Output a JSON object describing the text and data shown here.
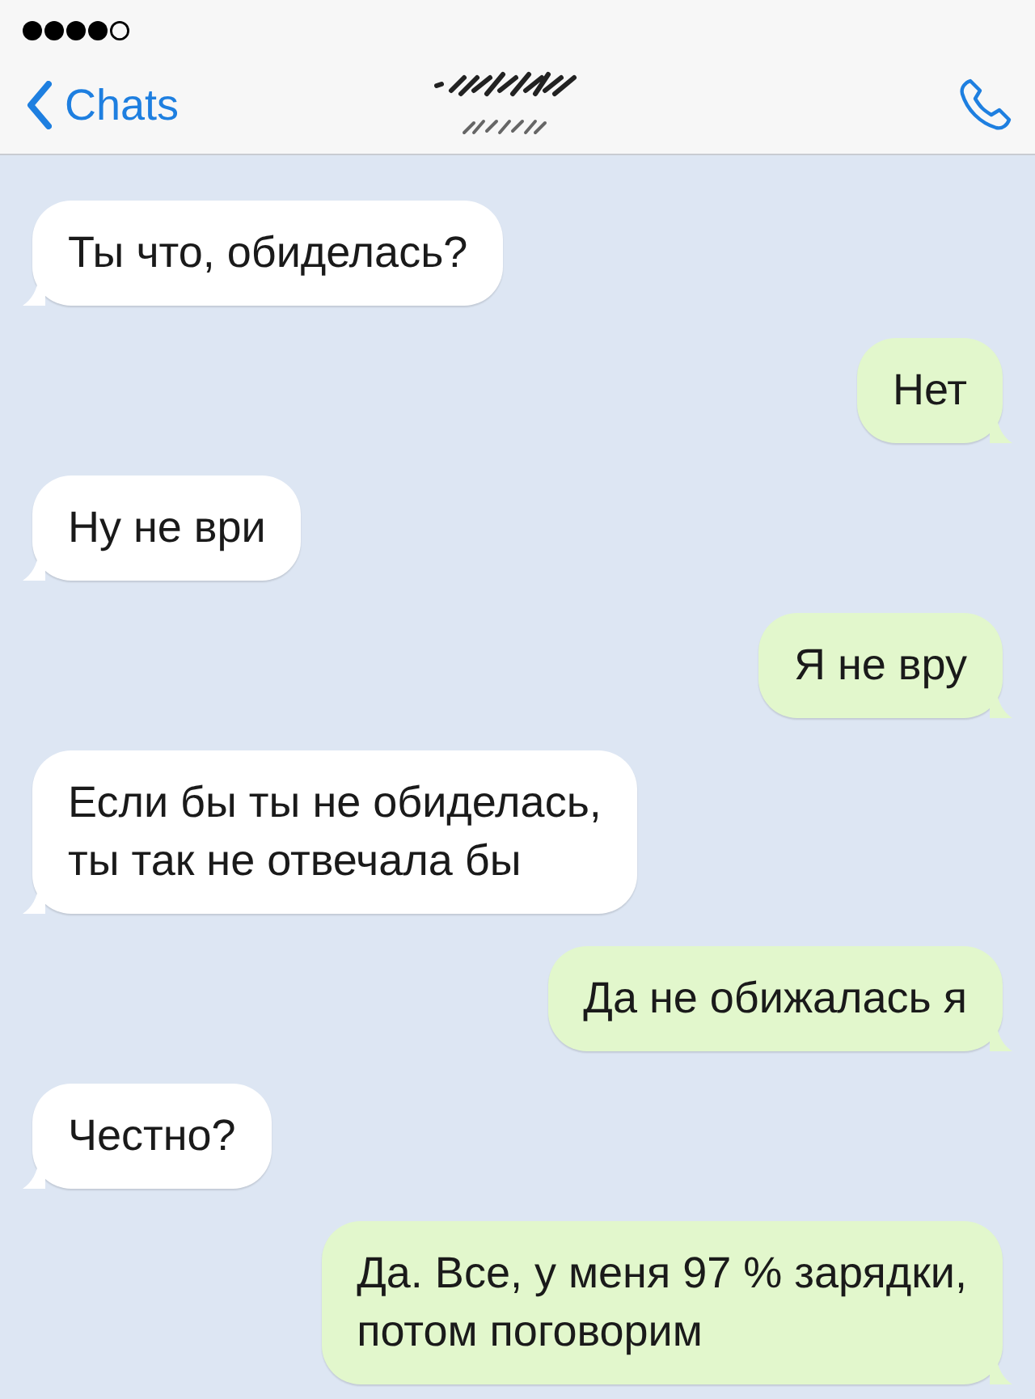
{
  "nav_bar": {
    "back_label": "Chats"
  },
  "messages": [
    {
      "kind": "incoming",
      "text": "Ты что, обиделась?"
    },
    {
      "kind": "outgoing",
      "text": "Нет"
    },
    {
      "kind": "incoming",
      "text": "Ну не ври"
    },
    {
      "kind": "outgoing",
      "text": "Я не вру"
    },
    {
      "kind": "incoming",
      "text": "Если бы ты не обиделась,\nты так не отвечала бы"
    },
    {
      "kind": "outgoing",
      "text": "Да не обижалась я"
    },
    {
      "kind": "incoming",
      "text": "Честно?"
    },
    {
      "kind": "outgoing",
      "text": "Да. Все, у меня 97 % зарядки,\nпотом поговорим"
    }
  ]
}
